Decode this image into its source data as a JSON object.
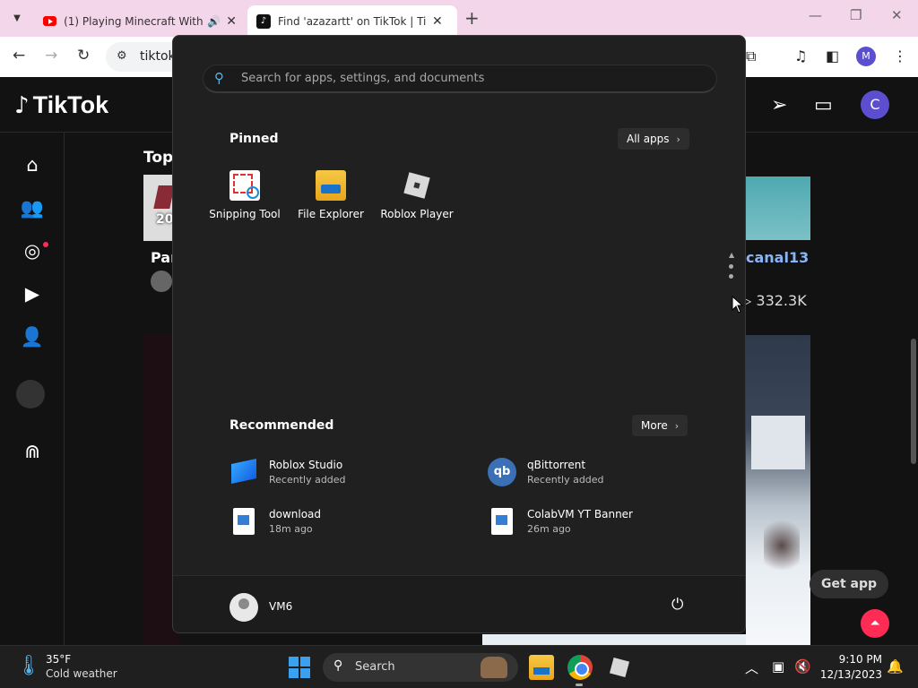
{
  "browser": {
    "tabs": [
      {
        "title": "(1) Playing Minecraft With (",
        "favicon": "youtube-icon"
      },
      {
        "title": "Find 'azazartt' on TikTok | TikTok",
        "favicon": "tiktok-icon"
      }
    ],
    "address": "tiktok",
    "profile_initial": "M"
  },
  "tiktok": {
    "logo_text": "TikTok",
    "avatar_initial": "C",
    "top_label": "Top",
    "left_card_number": "20",
    "left_card_title": "Par",
    "right_card_title": "canal13",
    "right_card_views": "332.3K",
    "get_app_label": "Get app"
  },
  "start_menu": {
    "search_placeholder": "Search for apps, settings, and documents",
    "pinned_title": "Pinned",
    "all_apps_label": "All apps",
    "pinned": [
      {
        "label": "Snipping Tool",
        "icon": "snipping-tool-icon"
      },
      {
        "label": "File Explorer",
        "icon": "file-explorer-icon"
      },
      {
        "label": "Roblox Player",
        "icon": "roblox-icon"
      }
    ],
    "recommended_title": "Recommended",
    "more_label": "More",
    "recommended": [
      {
        "name": "Roblox Studio",
        "detail": "Recently added",
        "icon": "roblox-studio-icon"
      },
      {
        "name": "qBittorrent",
        "detail": "Recently added",
        "icon": "qbittorrent-icon"
      },
      {
        "name": "download",
        "detail": "18m ago",
        "icon": "image-file-icon"
      },
      {
        "name": "ColabVM YT Banner",
        "detail": "26m ago",
        "icon": "image-file-icon"
      }
    ],
    "user_name": "VM6"
  },
  "taskbar": {
    "weather_temp": "35°F",
    "weather_desc": "Cold weather",
    "search_label": "Search",
    "time": "9:10 PM",
    "date": "12/13/2023"
  },
  "colors": {
    "tiktok_red": "#fe2c55",
    "start_bg": "#202020",
    "taskbar_bg": "#1f1f1f",
    "tab_strip": "#f3d6ea"
  }
}
